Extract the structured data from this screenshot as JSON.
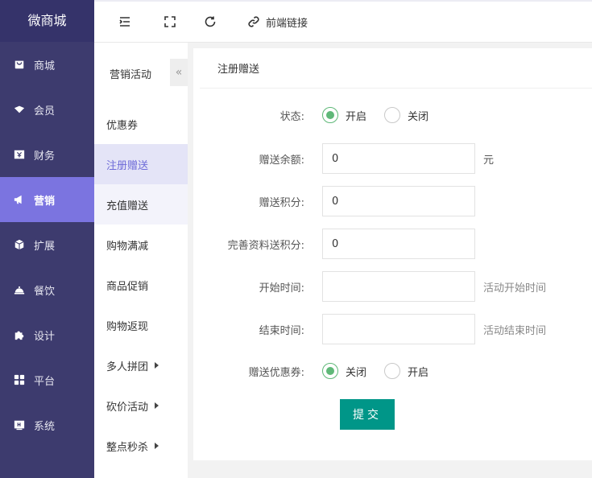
{
  "app": {
    "logo": "微商城"
  },
  "sidebar": {
    "items": [
      {
        "label": "商城",
        "icon": "shop-icon"
      },
      {
        "label": "会员",
        "icon": "member-icon"
      },
      {
        "label": "财务",
        "icon": "finance-icon"
      },
      {
        "label": "营销",
        "icon": "megaphone-icon"
      },
      {
        "label": "扩展",
        "icon": "cube-icon"
      },
      {
        "label": "餐饮",
        "icon": "dining-icon"
      },
      {
        "label": "设计",
        "icon": "puzzle-icon"
      },
      {
        "label": "平台",
        "icon": "grid-icon"
      },
      {
        "label": "系统",
        "icon": "system-icon"
      }
    ],
    "active": "营销"
  },
  "toolbar": {
    "frontend_link": "前端链接"
  },
  "subnav": {
    "title": "营销活动",
    "collapse": "«",
    "items": [
      {
        "label": "优惠券"
      },
      {
        "label": "注册赠送"
      },
      {
        "label": "充值赠送"
      },
      {
        "label": "购物满减"
      },
      {
        "label": "商品促销"
      },
      {
        "label": "购物返现"
      },
      {
        "label": "多人拼团"
      },
      {
        "label": "砍价活动"
      },
      {
        "label": "整点秒杀"
      }
    ],
    "active": "注册赠送"
  },
  "form": {
    "title": "注册赠送",
    "status": {
      "label": "状态:",
      "options": [
        "开启",
        "关闭"
      ],
      "selected": "开启"
    },
    "balance": {
      "label": "赠送余额:",
      "value": "0",
      "suffix": "元"
    },
    "points": {
      "label": "赠送积分:",
      "value": "0"
    },
    "profile_points": {
      "label": "完善资料送积分:",
      "value": "0"
    },
    "start_time": {
      "label": "开始时间:",
      "value": "",
      "hint": "活动开始时间"
    },
    "end_time": {
      "label": "结束时间:",
      "value": "",
      "hint": "活动结束时间"
    },
    "coupon": {
      "label": "赠送优惠券:",
      "options": [
        "关闭",
        "开启"
      ],
      "selected": "关闭"
    },
    "submit": "提交"
  },
  "colors": {
    "sidebar_bg": "#3d3b6e",
    "sidebar_active": "#7b74e0",
    "radio_on": "#5fb878",
    "submit_bg": "#009688"
  }
}
